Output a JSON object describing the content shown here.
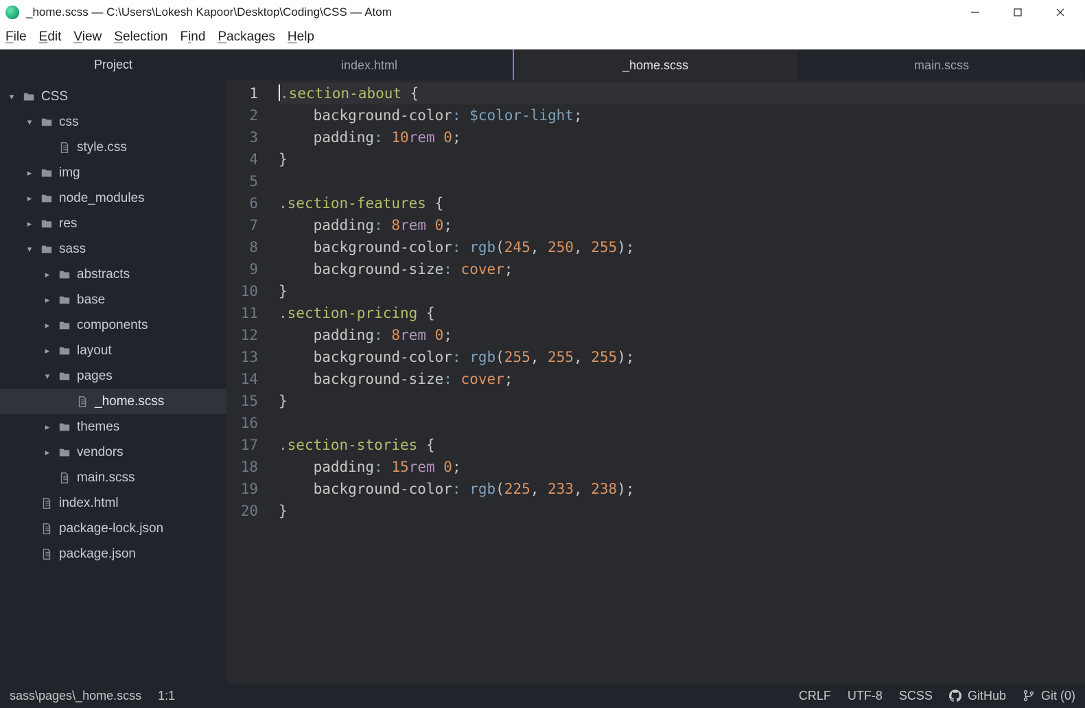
{
  "titlebar": {
    "title": "_home.scss — C:\\Users\\Lokesh Kapoor\\Desktop\\Coding\\CSS — Atom"
  },
  "menu": {
    "file": "File",
    "file_u": "F",
    "edit": "Edit",
    "edit_u": "E",
    "view": "View",
    "view_u": "V",
    "selection": "Selection",
    "selection_u": "S",
    "find": "Find",
    "find_u": "i",
    "packages": "Packages",
    "packages_u": "P",
    "help": "Help",
    "help_u": "H"
  },
  "sidebar": {
    "title": "Project",
    "rows": [
      {
        "depth": 0,
        "type": "folder",
        "chev": "down",
        "label": "CSS"
      },
      {
        "depth": 1,
        "type": "folder",
        "chev": "down",
        "label": "css"
      },
      {
        "depth": 2,
        "type": "file",
        "chev": "none",
        "label": "style.css"
      },
      {
        "depth": 1,
        "type": "folder",
        "chev": "right",
        "label": "img"
      },
      {
        "depth": 1,
        "type": "folder",
        "chev": "right",
        "label": "node_modules"
      },
      {
        "depth": 1,
        "type": "folder",
        "chev": "right",
        "label": "res"
      },
      {
        "depth": 1,
        "type": "folder",
        "chev": "down",
        "label": "sass"
      },
      {
        "depth": 2,
        "type": "folder",
        "chev": "right",
        "label": "abstracts"
      },
      {
        "depth": 2,
        "type": "folder",
        "chev": "right",
        "label": "base"
      },
      {
        "depth": 2,
        "type": "folder",
        "chev": "right",
        "label": "components"
      },
      {
        "depth": 2,
        "type": "folder",
        "chev": "right",
        "label": "layout"
      },
      {
        "depth": 2,
        "type": "folder",
        "chev": "down",
        "label": "pages"
      },
      {
        "depth": 3,
        "type": "file",
        "chev": "none",
        "label": "_home.scss",
        "selected": true
      },
      {
        "depth": 2,
        "type": "folder",
        "chev": "right",
        "label": "themes"
      },
      {
        "depth": 2,
        "type": "folder",
        "chev": "right",
        "label": "vendors"
      },
      {
        "depth": 2,
        "type": "file",
        "chev": "none",
        "label": "main.scss"
      },
      {
        "depth": 1,
        "type": "file",
        "chev": "none",
        "label": "index.html"
      },
      {
        "depth": 1,
        "type": "file",
        "chev": "none",
        "label": "package-lock.json"
      },
      {
        "depth": 1,
        "type": "file",
        "chev": "none",
        "label": "package.json"
      }
    ]
  },
  "tabs": [
    {
      "label": "index.html",
      "active": false
    },
    {
      "label": "_home.scss",
      "active": true
    },
    {
      "label": "main.scss",
      "active": false
    }
  ],
  "editor": {
    "cursor_line": 1,
    "lines": [
      [
        {
          "c": "cursor"
        },
        {
          "t": ".",
          "c": "dot"
        },
        {
          "t": "section-about",
          "c": "sel"
        },
        {
          "t": " {",
          "c": "brace"
        }
      ],
      [
        {
          "t": "    "
        },
        {
          "t": "background-color",
          "c": "prop"
        },
        {
          "t": ":",
          "c": "colon"
        },
        {
          "t": " "
        },
        {
          "t": "$color-light",
          "c": "var"
        },
        {
          "t": ";",
          "c": "punc"
        }
      ],
      [
        {
          "t": "    "
        },
        {
          "t": "padding",
          "c": "prop"
        },
        {
          "t": ":",
          "c": "colon"
        },
        {
          "t": " "
        },
        {
          "t": "10",
          "c": "num"
        },
        {
          "t": "rem",
          "c": "unit"
        },
        {
          "t": " "
        },
        {
          "t": "0",
          "c": "num"
        },
        {
          "t": ";",
          "c": "punc"
        }
      ],
      [
        {
          "t": "}",
          "c": "brace"
        }
      ],
      [],
      [
        {
          "t": ".",
          "c": "dot"
        },
        {
          "t": "section-features",
          "c": "sel"
        },
        {
          "t": " {",
          "c": "brace"
        }
      ],
      [
        {
          "t": "    "
        },
        {
          "t": "padding",
          "c": "prop"
        },
        {
          "t": ":",
          "c": "colon"
        },
        {
          "t": " "
        },
        {
          "t": "8",
          "c": "num"
        },
        {
          "t": "rem",
          "c": "unit"
        },
        {
          "t": " "
        },
        {
          "t": "0",
          "c": "num"
        },
        {
          "t": ";",
          "c": "punc"
        }
      ],
      [
        {
          "t": "    "
        },
        {
          "t": "background-color",
          "c": "prop"
        },
        {
          "t": ":",
          "c": "colon"
        },
        {
          "t": " "
        },
        {
          "t": "rgb",
          "c": "func"
        },
        {
          "t": "(",
          "c": "punc"
        },
        {
          "t": "245",
          "c": "num"
        },
        {
          "t": ", ",
          "c": "punc"
        },
        {
          "t": "250",
          "c": "num"
        },
        {
          "t": ", ",
          "c": "punc"
        },
        {
          "t": "255",
          "c": "num"
        },
        {
          "t": ")",
          "c": "punc"
        },
        {
          "t": ";",
          "c": "punc"
        }
      ],
      [
        {
          "t": "    "
        },
        {
          "t": "background-size",
          "c": "prop"
        },
        {
          "t": ":",
          "c": "colon"
        },
        {
          "t": " "
        },
        {
          "t": "cover",
          "c": "val"
        },
        {
          "t": ";",
          "c": "punc"
        }
      ],
      [
        {
          "t": "}",
          "c": "brace"
        }
      ],
      [
        {
          "t": ".",
          "c": "dot"
        },
        {
          "t": "section-pricing",
          "c": "sel"
        },
        {
          "t": " {",
          "c": "brace"
        }
      ],
      [
        {
          "t": "    "
        },
        {
          "t": "padding",
          "c": "prop"
        },
        {
          "t": ":",
          "c": "colon"
        },
        {
          "t": " "
        },
        {
          "t": "8",
          "c": "num"
        },
        {
          "t": "rem",
          "c": "unit"
        },
        {
          "t": " "
        },
        {
          "t": "0",
          "c": "num"
        },
        {
          "t": ";",
          "c": "punc"
        }
      ],
      [
        {
          "t": "    "
        },
        {
          "t": "background-color",
          "c": "prop"
        },
        {
          "t": ":",
          "c": "colon"
        },
        {
          "t": " "
        },
        {
          "t": "rgb",
          "c": "func"
        },
        {
          "t": "(",
          "c": "punc"
        },
        {
          "t": "255",
          "c": "num"
        },
        {
          "t": ", ",
          "c": "punc"
        },
        {
          "t": "255",
          "c": "num"
        },
        {
          "t": ", ",
          "c": "punc"
        },
        {
          "t": "255",
          "c": "num"
        },
        {
          "t": ")",
          "c": "punc"
        },
        {
          "t": ";",
          "c": "punc"
        }
      ],
      [
        {
          "t": "    "
        },
        {
          "t": "background-size",
          "c": "prop"
        },
        {
          "t": ":",
          "c": "colon"
        },
        {
          "t": " "
        },
        {
          "t": "cover",
          "c": "val"
        },
        {
          "t": ";",
          "c": "punc"
        }
      ],
      [
        {
          "t": "}",
          "c": "brace"
        }
      ],
      [],
      [
        {
          "t": ".",
          "c": "dot"
        },
        {
          "t": "section-stories",
          "c": "sel"
        },
        {
          "t": " {",
          "c": "brace"
        }
      ],
      [
        {
          "t": "    "
        },
        {
          "t": "padding",
          "c": "prop"
        },
        {
          "t": ":",
          "c": "colon"
        },
        {
          "t": " "
        },
        {
          "t": "15",
          "c": "num"
        },
        {
          "t": "rem",
          "c": "unit"
        },
        {
          "t": " "
        },
        {
          "t": "0",
          "c": "num"
        },
        {
          "t": ";",
          "c": "punc"
        }
      ],
      [
        {
          "t": "    "
        },
        {
          "t": "background-color",
          "c": "prop"
        },
        {
          "t": ":",
          "c": "colon"
        },
        {
          "t": " "
        },
        {
          "t": "rgb",
          "c": "func"
        },
        {
          "t": "(",
          "c": "punc"
        },
        {
          "t": "225",
          "c": "num"
        },
        {
          "t": ", ",
          "c": "punc"
        },
        {
          "t": "233",
          "c": "num"
        },
        {
          "t": ", ",
          "c": "punc"
        },
        {
          "t": "238",
          "c": "num"
        },
        {
          "t": ")",
          "c": "punc"
        },
        {
          "t": ";",
          "c": "punc"
        }
      ],
      [
        {
          "t": "}",
          "c": "brace"
        }
      ]
    ]
  },
  "statusbar": {
    "path": "sass\\pages\\_home.scss",
    "cursor": "1:1",
    "line_ending": "CRLF",
    "encoding": "UTF-8",
    "grammar": "SCSS",
    "github": "GitHub",
    "git": "Git (0)"
  }
}
